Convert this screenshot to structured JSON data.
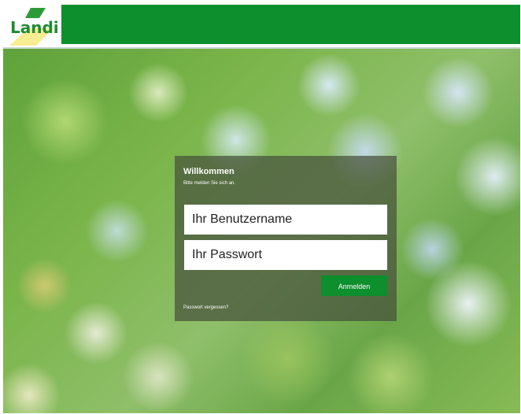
{
  "header": {
    "logo_text": "Landi",
    "bar_color": "#0c8f2c",
    "logo_icon": "landi-logo"
  },
  "login": {
    "title": "Willkommen",
    "subtitle": "Bitte melden Sie sich an.",
    "username_placeholder": "Ihr Benutzername",
    "username_value": "",
    "password_placeholder": "Ihr Passwort",
    "password_value": "",
    "submit_label": "Anmelden",
    "forgot_link": "Passwort vergessen?",
    "accent_color": "#0c8f2c"
  }
}
